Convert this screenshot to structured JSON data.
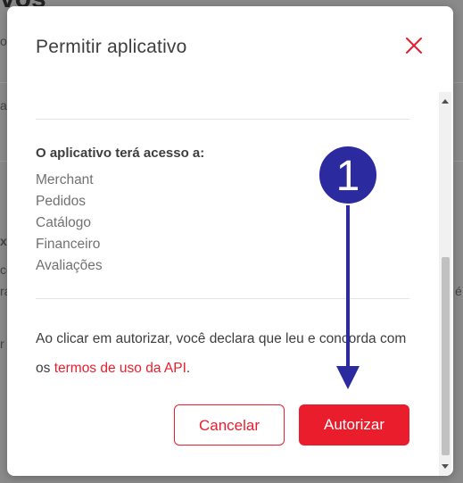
{
  "background": {
    "title_fragment": "vos",
    "side_fragments": [
      "ol",
      "a",
      "x",
      "co",
      "ra",
      "r",
      "é"
    ]
  },
  "modal": {
    "title": "Permitir aplicativo",
    "close_icon": "close-icon",
    "permissions_heading": "O aplicativo terá acesso a:",
    "permissions": [
      "Merchant",
      "Pedidos",
      "Catálogo",
      "Financeiro",
      "Avaliações"
    ],
    "consent_text": "Ao clicar em autorizar, você declara que leu e concorda com os ",
    "consent_link": "termos de uso da API",
    "consent_end": ".",
    "cancel_label": "Cancelar",
    "authorize_label": "Autorizar"
  },
  "annotation": {
    "step_number": "1"
  },
  "colors": {
    "accent": "#ea1d2c",
    "annotation": "#2b2a9e"
  }
}
